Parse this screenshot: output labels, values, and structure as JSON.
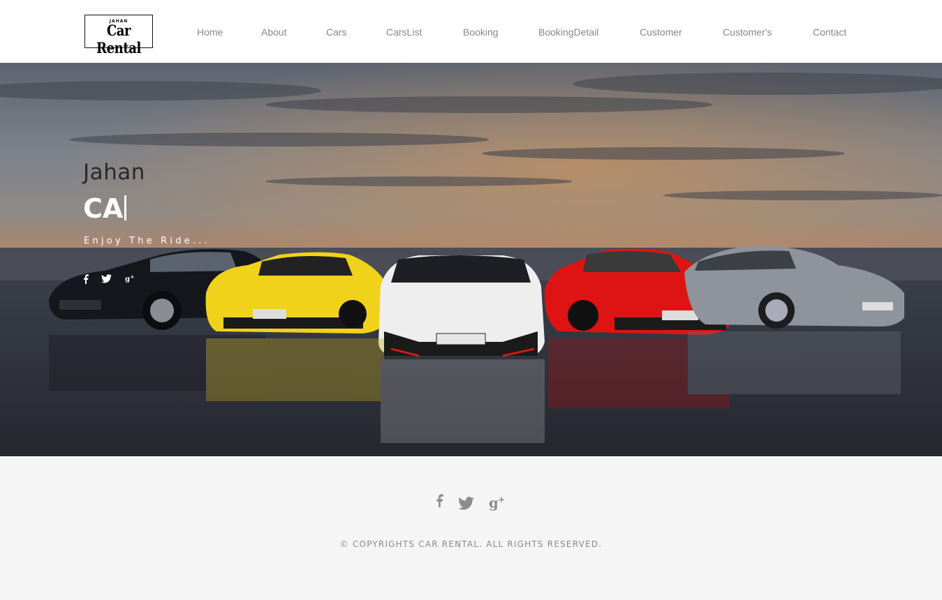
{
  "logo": {
    "small_text": "JAHAN",
    "brand": "Car Rental"
  },
  "nav": {
    "items": [
      {
        "label": "Home"
      },
      {
        "label": "About"
      },
      {
        "label": "Cars"
      },
      {
        "label": "CarsList"
      },
      {
        "label": "Booking"
      },
      {
        "label": "BookingDetail"
      },
      {
        "label": "Customer"
      },
      {
        "label": "Customer's"
      },
      {
        "label": "Contact"
      }
    ]
  },
  "hero": {
    "pretitle": "Jahan",
    "title": "CA",
    "tagline": "Enjoy The Ride...",
    "social": [
      "facebook-icon",
      "twitter-icon",
      "google-plus-icon"
    ]
  },
  "footer": {
    "social": [
      "facebook-icon",
      "twitter-icon",
      "google-plus-icon"
    ],
    "copyright": "© COPYRIGHTS CAR RENTAL. ALL RIGHTS RESERVED."
  },
  "colors": {
    "nav_text": "#888888",
    "footer_bg": "#f5f5f5",
    "hero_text": "#ffffff"
  }
}
